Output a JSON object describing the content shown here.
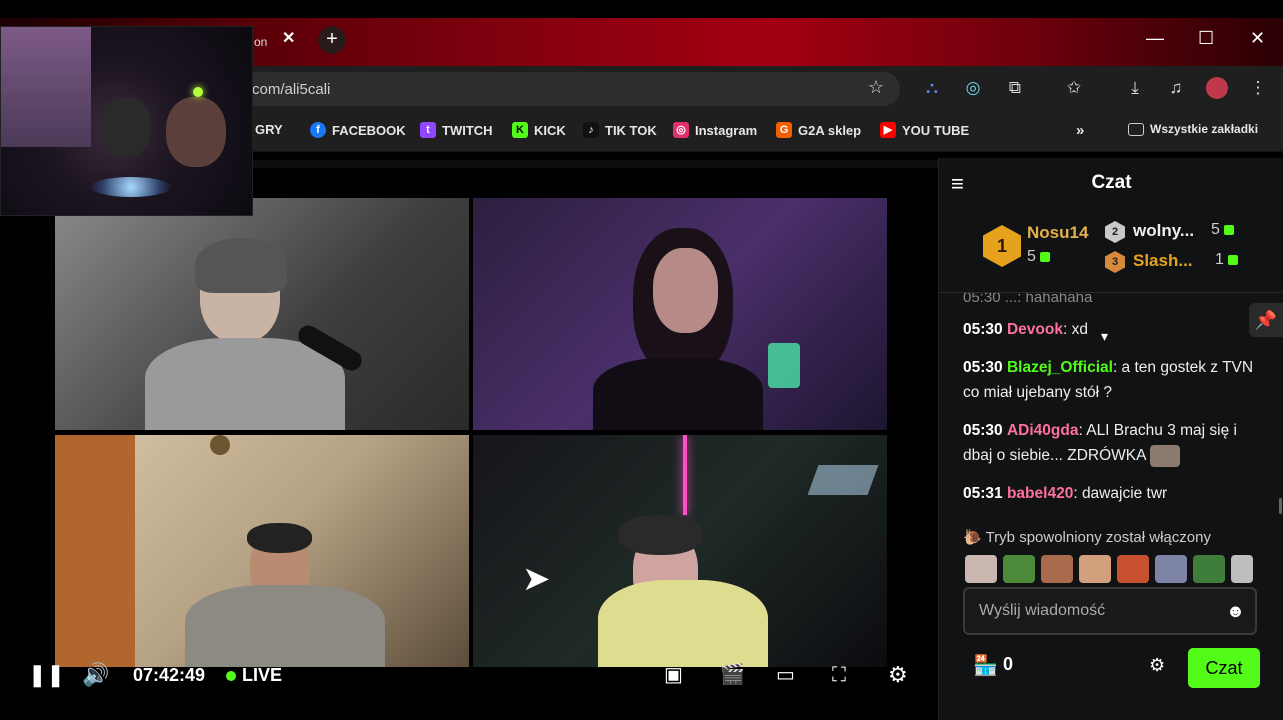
{
  "browser": {
    "tab_title": "on",
    "url": "com/ali5cali",
    "bookmarks": [
      {
        "label": "GRY",
        "icon": "folder-icon"
      },
      {
        "label": "FACEBOOK",
        "icon": "facebook-icon",
        "color": "#1877f2"
      },
      {
        "label": "TWITCH",
        "icon": "twitch-icon",
        "color": "#9146ff"
      },
      {
        "label": "KICK",
        "icon": "kick-icon",
        "color": "#53fc18"
      },
      {
        "label": "TIK TOK",
        "icon": "tiktok-icon",
        "color": "#111111"
      },
      {
        "label": "Instagram",
        "icon": "instagram-icon",
        "color": "#e1306c"
      },
      {
        "label": "G2A sklep",
        "icon": "g2a-icon",
        "color": "#f05f00"
      },
      {
        "label": "YOU TUBE",
        "icon": "youtube-icon",
        "color": "#ff0000"
      }
    ],
    "all_bookmarks": "Wszystkie zakładki",
    "more": "»"
  },
  "player": {
    "time": "07:42:49",
    "live": "LIVE"
  },
  "chat": {
    "title": "Czat",
    "leaders": [
      {
        "rank": "1",
        "name": "Nosu14",
        "score": "5"
      },
      {
        "rank": "2",
        "name": "wolny...",
        "score": "5"
      },
      {
        "rank": "3",
        "name": "Slash...",
        "score": "1"
      }
    ],
    "cut_message": "05:30 ...: hahahaha",
    "messages": [
      {
        "time": "05:30",
        "user": "Devook",
        "color": "#ff6fa0",
        "text": ": xd"
      },
      {
        "time": "05:30",
        "user": "Blazej_Official",
        "color": "#53fc18",
        "text": ": a ten gostek z TVN co miał ujebany stół ?"
      },
      {
        "time": "05:30",
        "user": "ADi40gda",
        "color": "#ff6fa0",
        "text": ": ALI Brachu 3 maj się i dbaj o siebie... ZDRÓWKA"
      },
      {
        "time": "05:31",
        "user": "babel420",
        "color": "#ff6fa0",
        "text": ": dawajcie twr"
      }
    ],
    "slow_mode": "Tryb spowolniony został włączony",
    "input_placeholder": "Wyślij wiadomość",
    "points": "0",
    "send_label": "Czat"
  }
}
